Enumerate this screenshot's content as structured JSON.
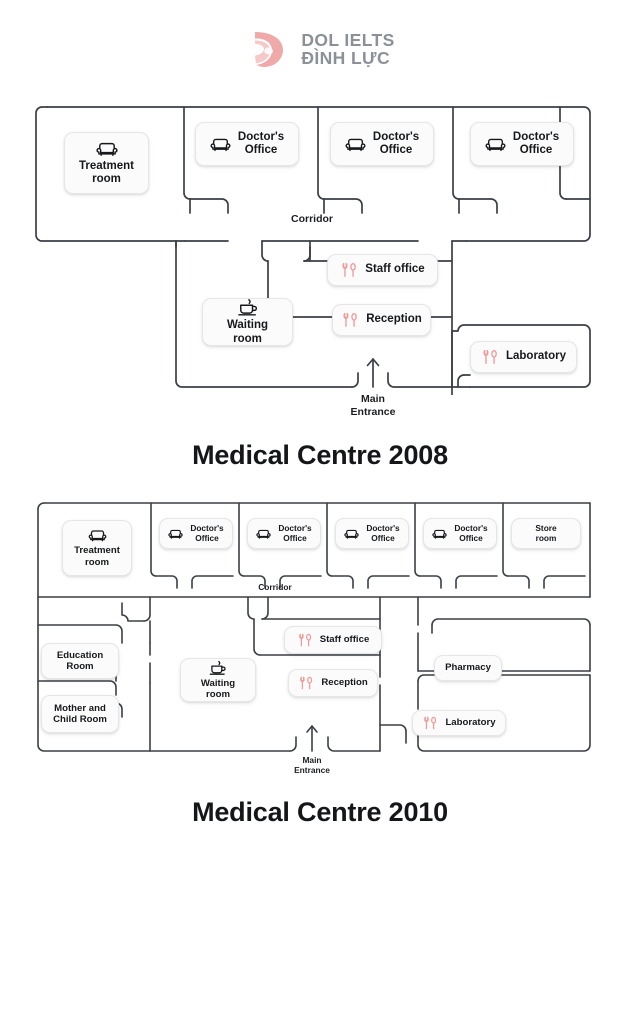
{
  "logo": {
    "line1": "DOL IELTS",
    "line2": "ĐÌNH LỰC",
    "mark_icon": "dol-leaf-mark",
    "color": "#eda7a7",
    "text_color": "#8c9199"
  },
  "plans": [
    {
      "id": "plan-2008",
      "title": "Medical Centre 2008",
      "corridor_label": "Corridor",
      "entrance_label": "Main\nEntrance",
      "rooms": [
        {
          "key": "treatment-room",
          "label": "Treatment\nroom",
          "icon": "sofa-icon",
          "icon_color": "#16181c"
        },
        {
          "key": "doctors-office-1",
          "label": "Doctor's\nOffice",
          "icon": "sofa-icon",
          "icon_color": "#16181c"
        },
        {
          "key": "doctors-office-2",
          "label": "Doctor's\nOffice",
          "icon": "sofa-icon",
          "icon_color": "#16181c"
        },
        {
          "key": "doctors-office-3",
          "label": "Doctor's\nOffice",
          "icon": "sofa-icon",
          "icon_color": "#16181c"
        },
        {
          "key": "staff-office",
          "label": "Staff office",
          "icon": "cutlery-icon",
          "icon_color": "#f09a9a"
        },
        {
          "key": "waiting-room",
          "label": "Waiting room",
          "icon": "coffee-cup-icon",
          "icon_color": "#16181c"
        },
        {
          "key": "reception",
          "label": "Reception",
          "icon": "cutlery-icon",
          "icon_color": "#f09a9a"
        },
        {
          "key": "laboratory",
          "label": "Laboratory",
          "icon": "cutlery-icon",
          "icon_color": "#f09a9a"
        }
      ]
    },
    {
      "id": "plan-2010",
      "title": "Medical Centre 2010",
      "corridor_label": "Corridor",
      "entrance_label": "Main\nEntrance",
      "rooms": [
        {
          "key": "treatment-room",
          "label": "Treatment\nroom",
          "icon": "sofa-icon",
          "icon_color": "#16181c"
        },
        {
          "key": "doctors-office-1",
          "label": "Doctor's\nOffice",
          "icon": "sofa-icon",
          "icon_color": "#16181c"
        },
        {
          "key": "doctors-office-2",
          "label": "Doctor's\nOffice",
          "icon": "sofa-icon",
          "icon_color": "#16181c"
        },
        {
          "key": "doctors-office-3",
          "label": "Doctor's\nOffice",
          "icon": "sofa-icon",
          "icon_color": "#16181c"
        },
        {
          "key": "doctors-office-4",
          "label": "Doctor's\nOffice",
          "icon": "sofa-icon",
          "icon_color": "#16181c"
        },
        {
          "key": "store-room",
          "label": "Store\nroom",
          "icon": "none",
          "icon_color": "#16181c"
        },
        {
          "key": "education-room",
          "label": "Education\nRoom",
          "icon": "none",
          "icon_color": "#16181c"
        },
        {
          "key": "mother-and-child-room",
          "label": "Mother and\nChild Room",
          "icon": "none",
          "icon_color": "#16181c"
        },
        {
          "key": "staff-office",
          "label": "Staff office",
          "icon": "cutlery-icon",
          "icon_color": "#f09a9a"
        },
        {
          "key": "waiting-room",
          "label": "Waiting room",
          "icon": "coffee-cup-icon",
          "icon_color": "#16181c"
        },
        {
          "key": "reception",
          "label": "Reception",
          "icon": "cutlery-icon",
          "icon_color": "#f09a9a"
        },
        {
          "key": "pharmacy",
          "label": "Pharmacy",
          "icon": "none",
          "icon_color": "#16181c"
        },
        {
          "key": "laboratory",
          "label": "Laboratory",
          "icon": "cutlery-icon",
          "icon_color": "#f09a9a"
        }
      ]
    }
  ],
  "style": {
    "wall_color": "#3b3f46",
    "background": "#ffffff"
  }
}
